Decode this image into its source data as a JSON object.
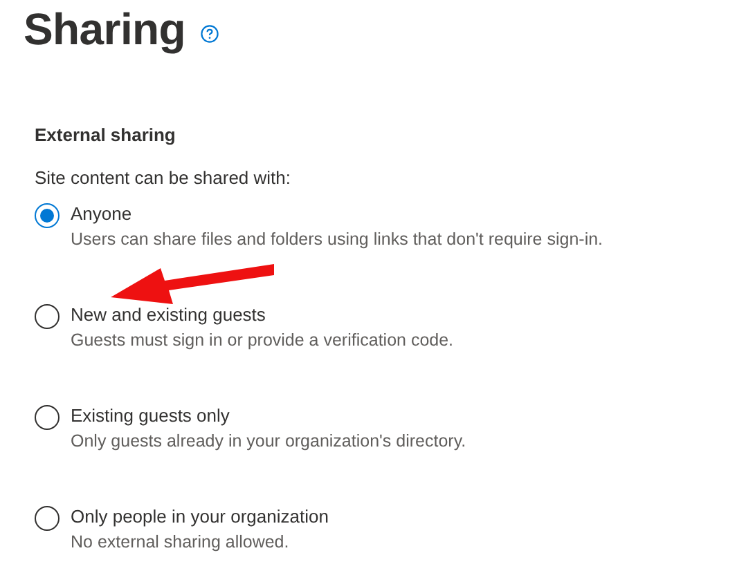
{
  "page_title": "Sharing",
  "section_title": "External sharing",
  "prompt": "Site content can be shared with:",
  "options": [
    {
      "label": "Anyone",
      "description": "Users can share files and folders using links that don't require sign-in.",
      "selected": true
    },
    {
      "label": "New and existing guests",
      "description": "Guests must sign in or provide a verification code.",
      "selected": false
    },
    {
      "label": "Existing guests only",
      "description": "Only guests already in your organization's directory.",
      "selected": false
    },
    {
      "label": "Only people in your organization",
      "description": "No external sharing allowed.",
      "selected": false
    }
  ]
}
